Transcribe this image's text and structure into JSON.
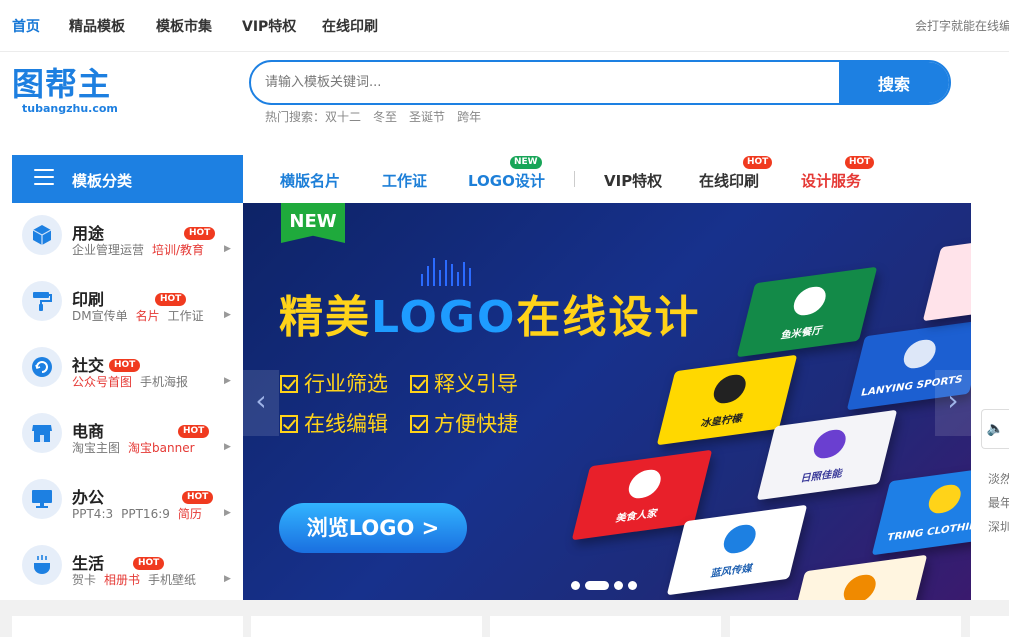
{
  "topnav": {
    "items": [
      "首页",
      "精品模板",
      "模板市集",
      "VIP特权",
      "在线印刷"
    ],
    "slogan": "会打字就能在线编"
  },
  "header": {
    "logo_text": "图帮主",
    "logo_domain": "tubangzhu.com",
    "search_placeholder": "请输入模板关键词...",
    "search_button": "搜索",
    "hot_label": "热门搜索：",
    "hot_terms": [
      "双十二",
      "冬至",
      "圣诞节",
      "跨年"
    ]
  },
  "category": {
    "title": "模板分类"
  },
  "mainnav": {
    "items": [
      "横版名片",
      "工作证",
      "LOGO设计",
      "VIP特权",
      "在线印刷",
      "设计服务"
    ],
    "new_tag": "NEW",
    "hot_tag": "HOT"
  },
  "sidebar": {
    "items": [
      {
        "title": "用途",
        "links": [
          "企业管理运营",
          "培训/教育"
        ],
        "hot": "HOT",
        "icon": "cube-icon"
      },
      {
        "title": "印刷",
        "links": [
          "DM宣传单",
          "名片",
          "工作证"
        ],
        "hot": "HOT",
        "icon": "paint-roller-icon"
      },
      {
        "title": "社交",
        "links": [
          "公众号首图",
          "手机海报"
        ],
        "hot": "HOT",
        "icon": "refresh-icon"
      },
      {
        "title": "电商",
        "links": [
          "淘宝主图",
          "淘宝banner"
        ],
        "hot": "HOT",
        "icon": "shop-icon"
      },
      {
        "title": "办公",
        "links": [
          "PPT4:3",
          "PPT16:9",
          "简历"
        ],
        "hot": "HOT",
        "icon": "monitor-icon"
      },
      {
        "title": "生活",
        "links": [
          "贺卡",
          "相册书",
          "手机壁纸"
        ],
        "hot": "HOT",
        "icon": "cup-icon"
      }
    ]
  },
  "banner": {
    "ribbon": "NEW",
    "headline_pre": "精美",
    "headline_logo": "LOGO",
    "headline_post": "在线设计",
    "features": [
      "行业筛选",
      "释义引导",
      "在线编辑",
      "方便快捷"
    ],
    "browse_button": "浏览LOGO >",
    "cards": [
      "鱼米餐厅",
      "LANYING SPORTS",
      "冰皇柠檬",
      "日照佳能",
      "美食人家",
      "TRING CLOTHING",
      "蓝风传媒"
    ],
    "colors": {
      "yellow": "#ffd319",
      "blue": "#1e9cff"
    }
  },
  "right_strip": {
    "lines": [
      "淡然",
      "最年",
      "深圳"
    ]
  },
  "colors": {
    "primary": "#1d80e2",
    "hot": "#f03a1f",
    "new": "#18a558"
  }
}
